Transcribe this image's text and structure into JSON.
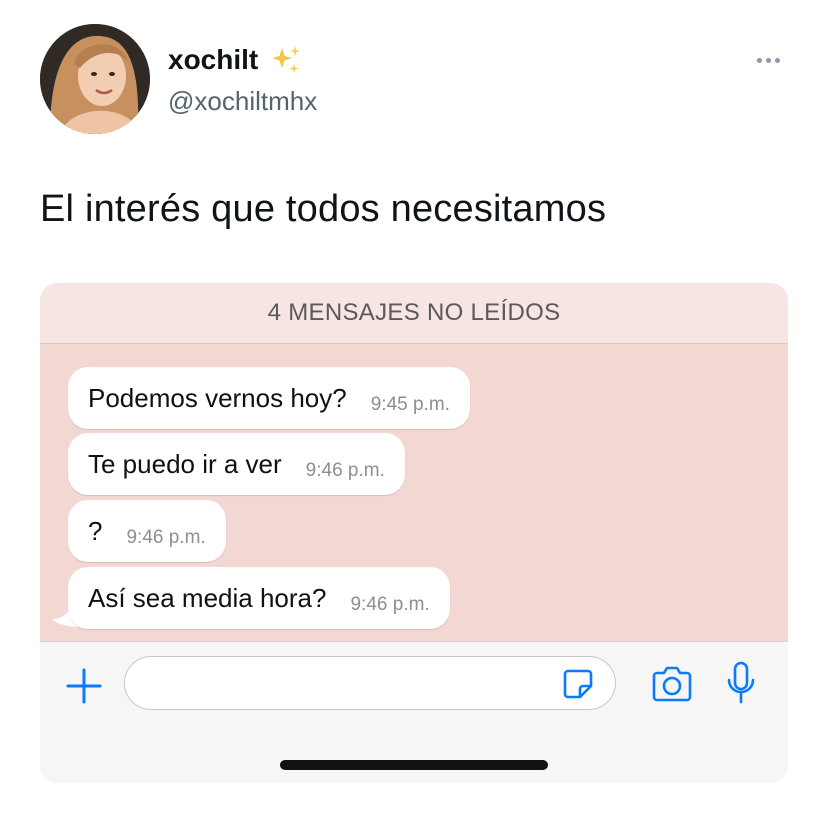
{
  "tweet": {
    "author_name": "xochilt",
    "author_emoji": "sparkles-icon",
    "handle": "@xochiltmhx",
    "text": "El interés que todos necesitamos"
  },
  "chat": {
    "unread_banner": "4 MENSAJES NO LEÍDOS",
    "messages": [
      {
        "text": "Podemos vernos hoy?",
        "time": "9:45 p.m."
      },
      {
        "text": "Te puedo ir a ver",
        "time": "9:46 p.m."
      },
      {
        "text": "?",
        "time": "9:46 p.m."
      },
      {
        "text": "Así sea media hora?",
        "time": "9:46 p.m."
      }
    ],
    "input_icons": [
      "plus-icon",
      "sticker-icon",
      "camera-icon",
      "microphone-icon"
    ]
  },
  "colors": {
    "chat_background": "#f2d7d3",
    "ios_blue": "#0a7aff"
  }
}
